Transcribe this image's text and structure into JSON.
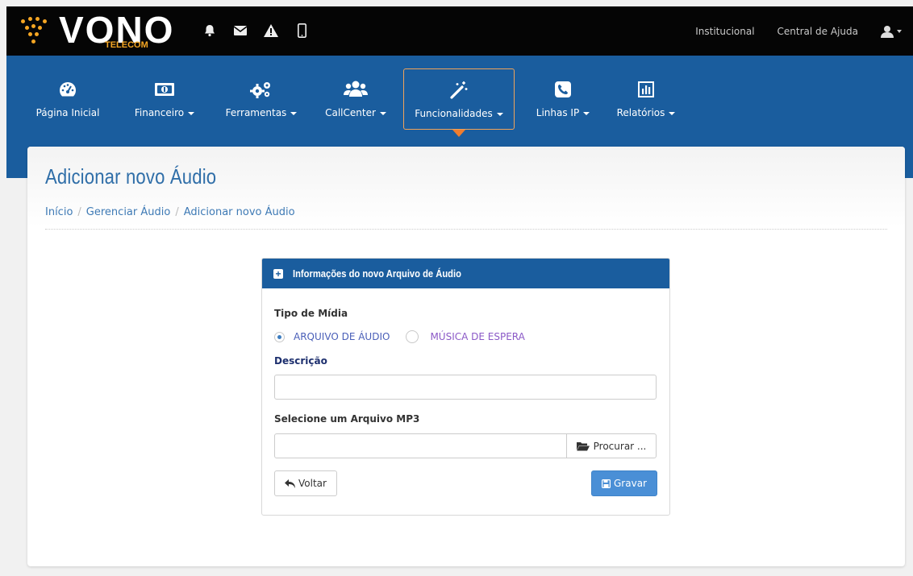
{
  "header": {
    "brand": "VONO",
    "brand_sub": "TELECOM",
    "links": [
      "Institucional",
      "Central de Ajuda"
    ]
  },
  "nav": {
    "items": [
      {
        "label": "Página Inicial",
        "icon": "dashboard-icon",
        "dropdown": false
      },
      {
        "label": "Financeiro",
        "icon": "money-icon",
        "dropdown": true
      },
      {
        "label": "Ferramentas",
        "icon": "gears-icon",
        "dropdown": true
      },
      {
        "label": "CallCenter",
        "icon": "users-icon",
        "dropdown": true
      },
      {
        "label": "Funcionalidades",
        "icon": "magic-wand-icon",
        "dropdown": true,
        "active": true
      },
      {
        "label": "Linhas IP",
        "icon": "phone-icon",
        "dropdown": true
      },
      {
        "label": "Relatórios",
        "icon": "bar-chart-icon",
        "dropdown": true
      }
    ]
  },
  "page": {
    "title": "Adicionar novo Áudio",
    "breadcrumb": [
      "Início",
      "Gerenciar Áudio",
      "Adicionar novo Áudio"
    ]
  },
  "panel": {
    "title": "Informações do novo Arquivo de Áudio",
    "media_type_label": "Tipo de Mídia",
    "options": [
      {
        "label": "ARQUIVO DE ÁUDIO",
        "selected": true
      },
      {
        "label": "MÚSICA DE ESPERA",
        "selected": false
      }
    ],
    "description_label": "Descrição",
    "description_value": "",
    "file_label": "Selecione um Arquivo MP3",
    "file_value": "",
    "browse_label": "Procurar ...",
    "back_label": "Voltar",
    "save_label": "Gravar"
  },
  "colors": {
    "nav_blue": "#1a5d9e",
    "accent_orange": "#ef7d2f",
    "save_button": "#4a8fd6",
    "title_blue": "#2f6ea8"
  }
}
